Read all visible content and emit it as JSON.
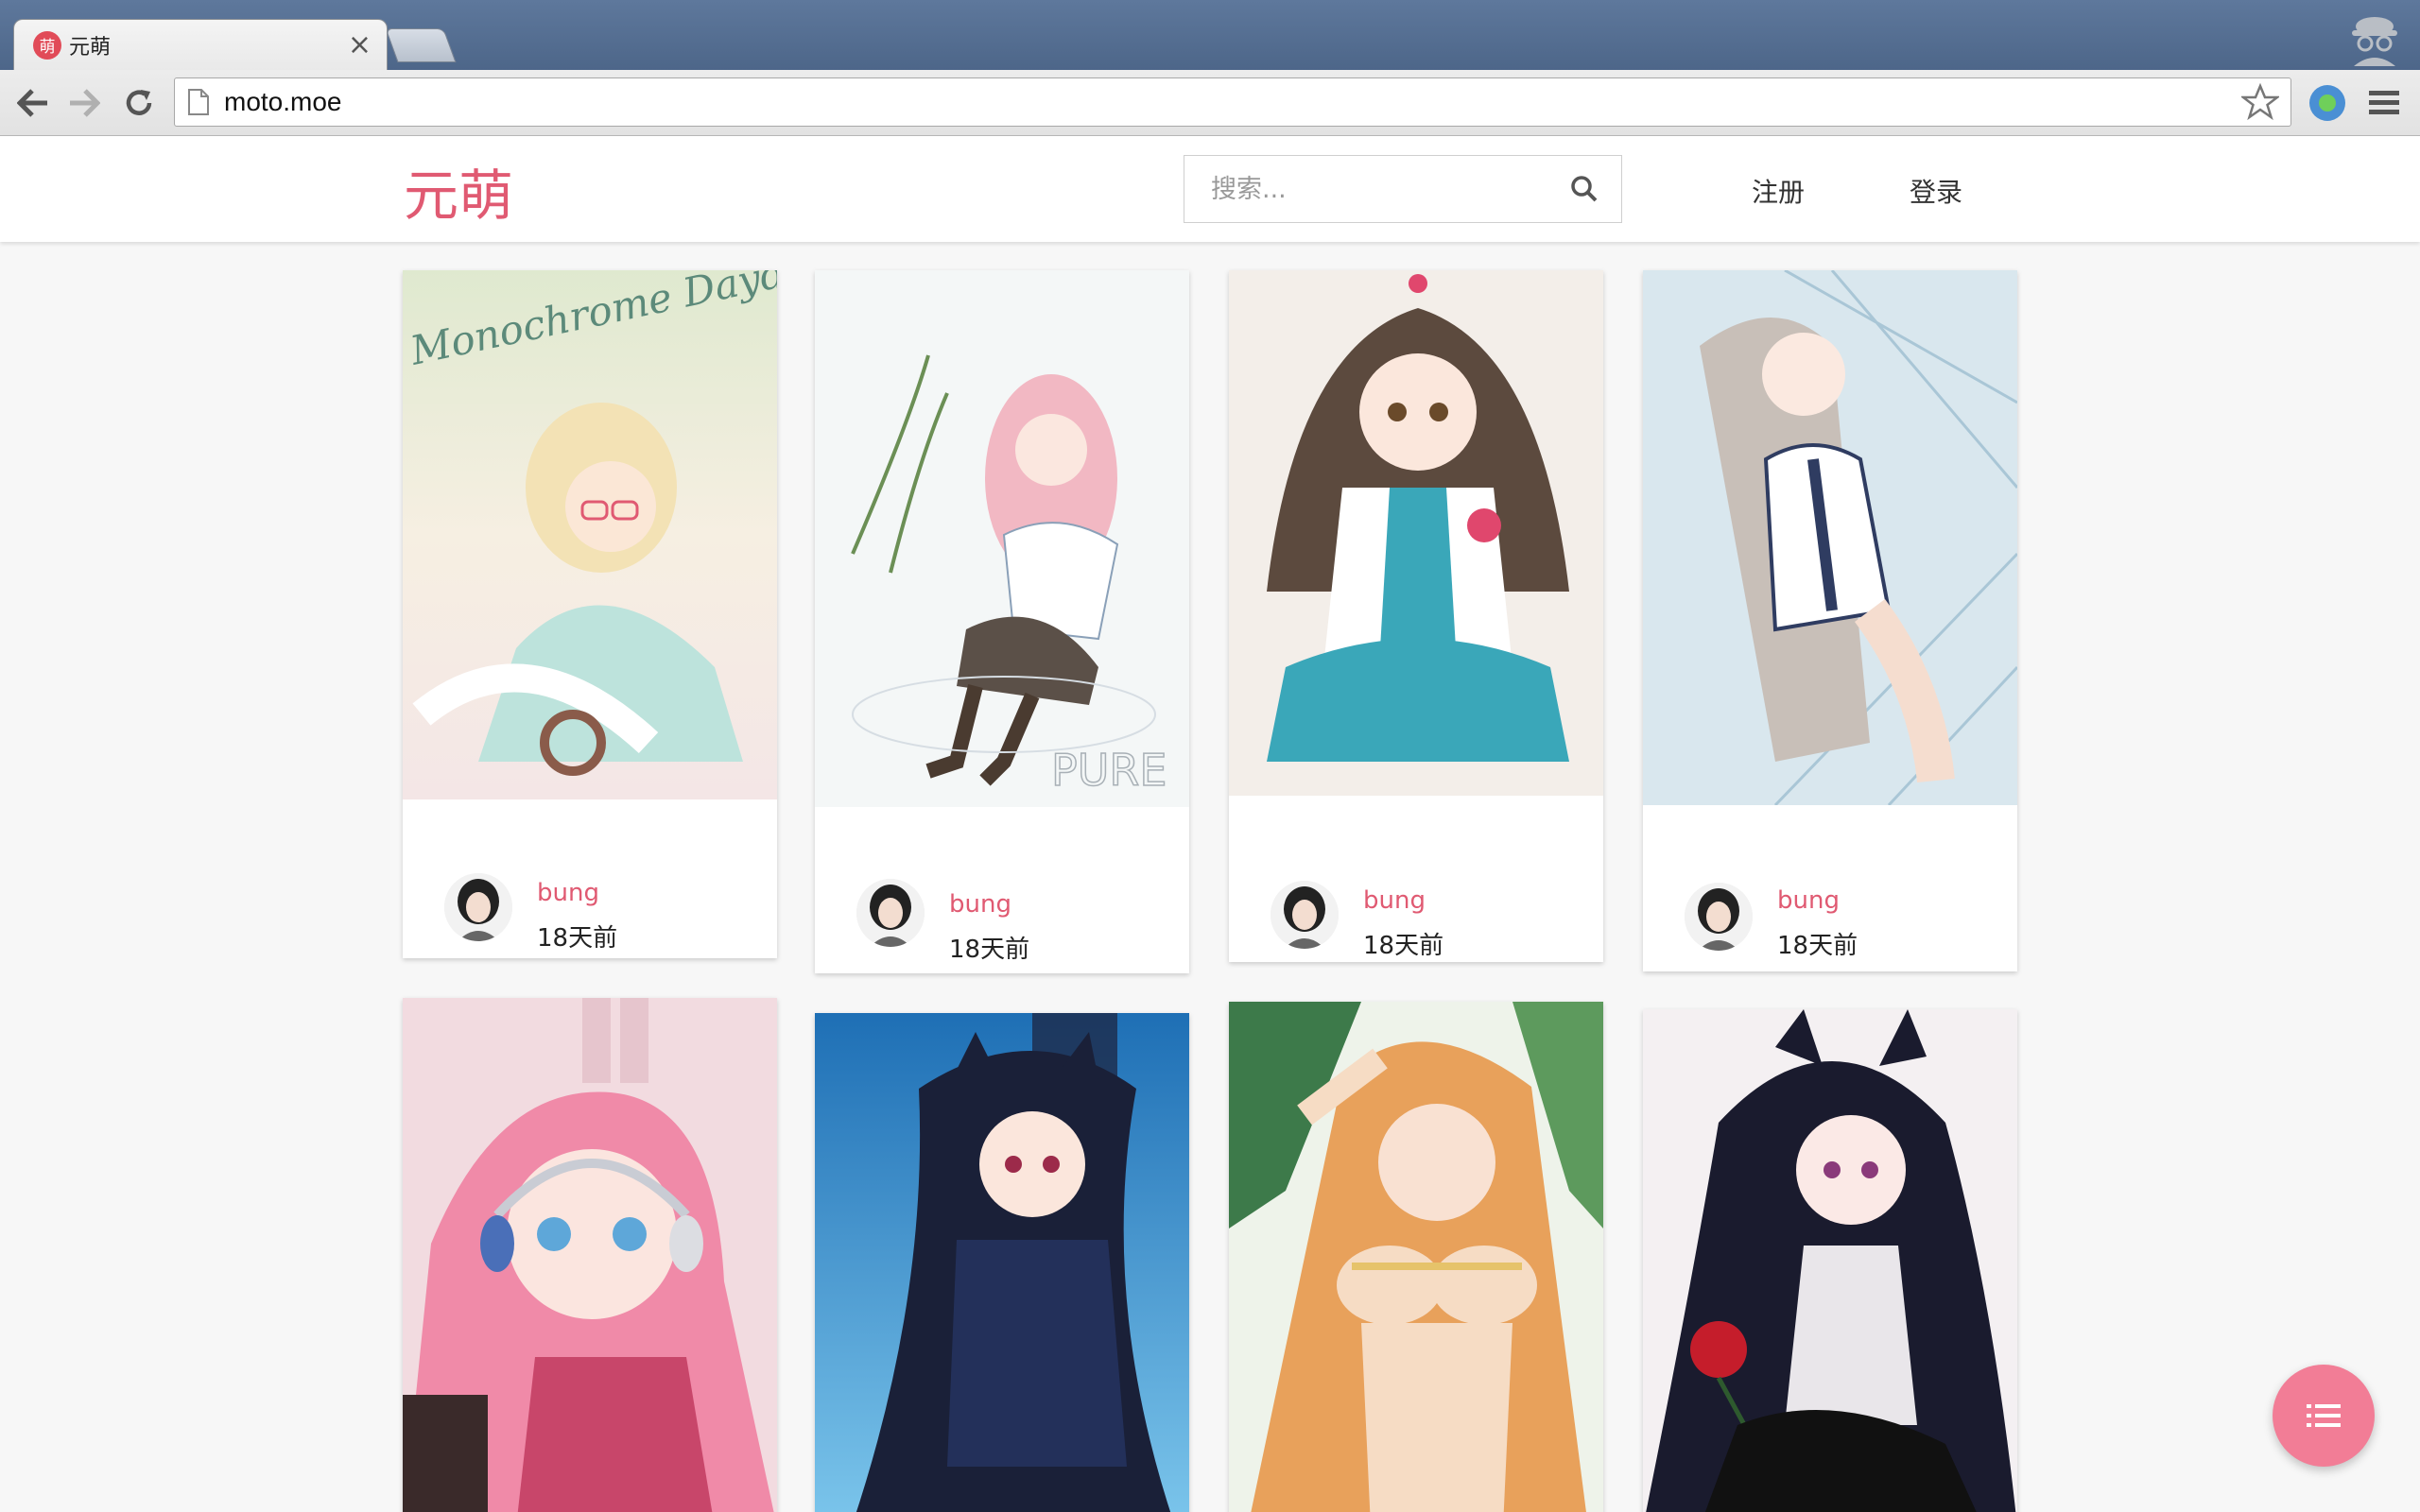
{
  "browser": {
    "tab_title": "元萌",
    "tab_favicon_text": "萌",
    "tab_close": "×",
    "url": "moto.moe"
  },
  "site": {
    "logo": "元萌",
    "search_placeholder": "搜索...",
    "register": "注册",
    "login": "登录"
  },
  "cards": [
    {
      "author": "bung",
      "time": "18天前",
      "art": "blonde-cat-girl-glasses",
      "palette": [
        "#dfe9cf",
        "#f3e2b5",
        "#f6c8b3"
      ]
    },
    {
      "author": "bung",
      "time": "18天前",
      "art": "pink-hair-pure-sailor",
      "palette": [
        "#f4f7f7",
        "#f2b8c3",
        "#6f6258"
      ]
    },
    {
      "author": "bung",
      "time": "18天前",
      "art": "idol-teal-dress",
      "palette": [
        "#f3eee9",
        "#5c4a3e",
        "#3aa7b9"
      ]
    },
    {
      "author": "bung",
      "time": "18天前",
      "art": "silver-hair-glass-window",
      "palette": [
        "#d9e7ee",
        "#c8bfb8",
        "#2f3c61"
      ]
    },
    {
      "author": "",
      "time": "",
      "art": "pink-hair-headphones",
      "palette": [
        "#f2dbe0",
        "#f08aa8",
        "#5ea7d9"
      ]
    },
    {
      "author": "",
      "time": "",
      "art": "black-hair-cat-ears-blue",
      "palette": [
        "#5eb0df",
        "#1d2b4a",
        "#2a7fbf"
      ]
    },
    {
      "author": "",
      "time": "",
      "art": "summer-bikini-palm",
      "palette": [
        "#7aa57a",
        "#e8a15b",
        "#f6dcc4"
      ]
    },
    {
      "author": "",
      "time": "",
      "art": "gothic-lolita-rose",
      "palette": [
        "#f4f0f2",
        "#1a1b2e",
        "#c51d2b"
      ]
    }
  ],
  "icons": {
    "back": "back-arrow-icon",
    "forward": "forward-arrow-icon",
    "reload": "reload-icon",
    "bookmark": "star-icon",
    "menu": "hamburger-menu-icon",
    "search": "search-icon",
    "fab": "list-icon",
    "incognito": "incognito-icon"
  },
  "colors": {
    "accent": "#e05a72",
    "fab": "#f27d96"
  }
}
